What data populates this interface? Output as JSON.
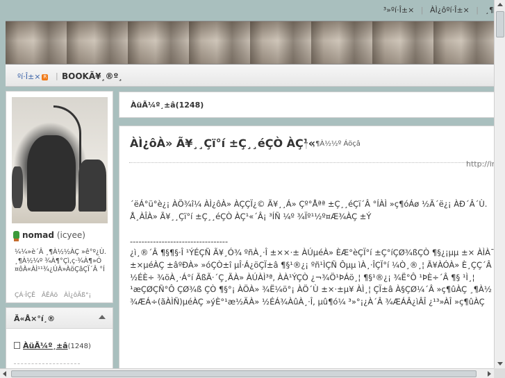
{
  "toplinks": {
    "item1": "³»ºí·Î±×",
    "item2": "ÀÌ¿ôºí·Î±×",
    "item3": "¸¶"
  },
  "nav": {
    "home": "ºí·Î±×",
    "rss_badge": "R",
    "book": "BOOKÃ¥¸®º¸"
  },
  "profile": {
    "name": "nomad",
    "id": "(icyee)",
    "bio": "¼¼»è´Â ¸¶À½½ÀÇ »ê°º¿Ù. ¸¶À½¼º ¾À¶°Çì,ç·¾À¶»Ó ¤ôÀ«ÀÌ¹¹¾¿ÚÀ»ÀöÇãÇÏ´Â °Í",
    "links": [
      "ÇÁ·ÎÇÊ",
      "ÂÊÁö",
      "ÀÌ¿ôÃß°¡"
    ]
  },
  "categories": {
    "heading": "Ä«Å×°í¸®",
    "item_label": "ÀüÃ¼º¸±â",
    "item_count": "(1248)"
  },
  "main_header": {
    "label": "ÀüÃ¼º¸±â",
    "count": "(1248)"
  },
  "post": {
    "title": "ÀÌ¿ôÀ» Ã¥¸¸Çï°í ±Ç¸¸éÇÒ ÀÇ¹«",
    "category": "¸¶À½½º Áöçâ",
    "url": "http://in",
    "para1_line1": "´ëÁ°ü°è¿¡ ÀÖ¾î¼­ ÀÌ¿ôÀ» ÀÇÇÏ¿© Ã¥¸¸Á» Çº°Åªª ±Ç¸¸éÇï´Â °ÍÀÌ »ç¶óÁø ½Ã´ë¿¡ ÀÐ´Â´Ù.",
    "para1_line2": "Å¸ÀÎÀ» Ã¥¸¸Çï°í ±Ç¸¸éÇÒ ÀÇ¹«´Â¡ ³ÍÑ ¼º ¾Ïº¹½º¤Æ¾ÀÇ ±Ý",
    "divider": "----------------------------------",
    "para2_line1": "¿ì¸®´Â ¶§¶§·Î ¹ÝÉÇÑ Ã¥¸Ó¾ ºñÀ¸·Î ±××·± ÀÚµéÀ» ÈÆ°èÇÏ°í ±Ç°íÇØ¾ßÇÒ ¶§¿¡µµ ±× ÀÌÀ¯",
    "para2_line2": "±×µéÀÇ ±âºÐÀ» »óÇÒ±î µÎ·Á¿öÇÏ±â ¶§¹®¿¡ ºñ¹ÌÇÑ Ôµµ ìÀ¸·ÎÇÏ°í ¼Ò¸®¸¦ Ã¥ÀÓÀ» È¸ÇÇ´Â ºê",
    "para2_line3": "½ÉÈ÷ ¾öÀ¸·Á°í ÃßÃ·´Ç¸ÃÀ» ÀÚÀÌ³ª, ÀÀ¹ÝÇÒ ¿¬¾Ö¹ÞÁö¸¦ ¶§¹®¿¡ ¾Ë°Ô ¹ÞÈ÷´Â ¶§ ¹Ì¸¦",
    "para3_line1": "¹æÇØÇÑ°Ô ÇØ¾ß ÇÒ ¶§°¡ ÀÖÀ» ¾Ë¼ö°¡ ÀÖ´Ù ±×·±µ¥ ÀÌ¸¦ ÇÏ±â À§ÇØ¼­´Â »ç¶ûÀÇ ¸¶À½ ¸¸ÀÌ ÇÊ¿ä",
    "para3_line2": "¾ÆÁ÷(ãÀÌÑ)µéÀÇ »ýÈ°¹æ½ÄÀ» ½ÉÁ¾ÀûÀ¸·Î, µû¶ó¼­ ³»°¡¿À´Â ¾ÆÁÂ¿ìÂÎ ¿¹³»ÀÎ »ç¶ûÀÇ"
  }
}
